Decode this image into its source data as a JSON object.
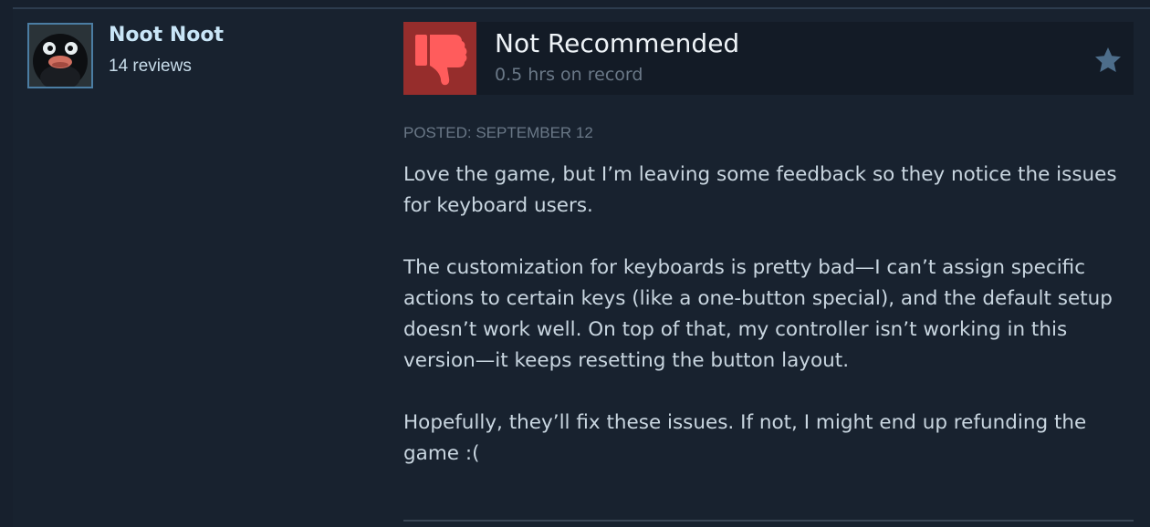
{
  "author": {
    "name": "Noot Noot",
    "reviews_count": "14 reviews",
    "avatar_icon": "penguin-avatar-icon"
  },
  "verdict": {
    "title": "Not Recommended",
    "hours": "0.5 hrs on record",
    "icon": "thumbs-down-icon",
    "icon_bg_color": "#962d2c",
    "award_icon": "star-icon"
  },
  "review": {
    "posted": "POSTED: SEPTEMBER 12",
    "paragraphs": [
      "Love the game, but I’m leaving some feedback so they notice the issues for keyboard users.",
      "The customization for keyboards is pretty bad—I can’t assign specific actions to certain keys (like a one-button special), and the default setup doesn’t work well. On top of that, my controller isn’t working in this version—it keeps resetting the button layout.",
      "Hopefully, they’ll fix these issues. If not, I might end up refunding the game :("
    ]
  },
  "colors": {
    "page_background": "#17202d",
    "author_name": "#c9e6f8",
    "body_text": "#c9d6e0",
    "muted_text": "#6a7887"
  }
}
